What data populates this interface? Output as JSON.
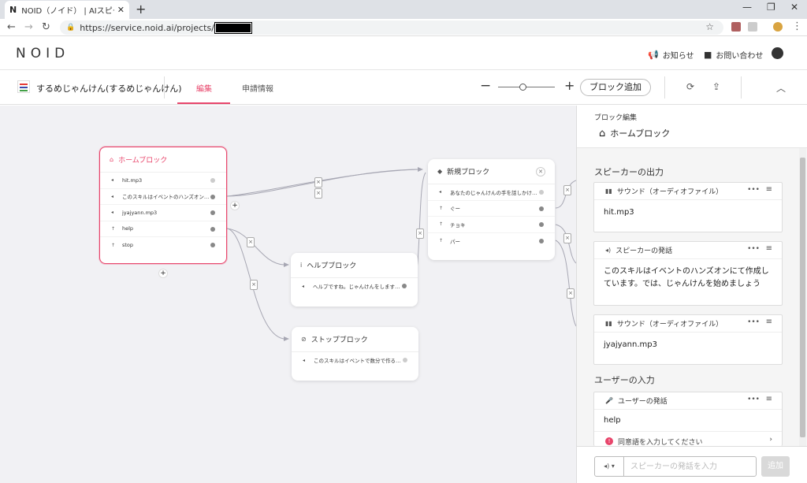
{
  "browser": {
    "tab_title": "NOID（ノイド） | AIスピーカースキルを",
    "tab_favicon": "N",
    "url": "https://service.noid.ai/projects/"
  },
  "header": {
    "logo": "NOID",
    "news": "お知らせ",
    "contact": "お問い合わせ"
  },
  "project": {
    "name": "するめじゃんけん(するめじゃんけん)",
    "tabs": [
      "編集",
      "申請情報"
    ],
    "add_block": "ブロック追加"
  },
  "canvas": {
    "home_block": {
      "title": "ホームブロック",
      "rows": [
        "hit.mp3",
        "このスキルはイベントのハンズオン…",
        "jyajyann.mp3",
        "help",
        "stop"
      ]
    },
    "new_block": {
      "title": "新規ブロック",
      "rows": [
        "あなたのじゃんけんの手を話しかけ…",
        "ぐー",
        "チョキ",
        "パー"
      ]
    },
    "help_block": {
      "title": "ヘルプブロック",
      "rows": [
        "ヘルプですね。じゃんけんをします…"
      ]
    },
    "stop_block": {
      "title": "ストップブロック",
      "rows": [
        "このスキルはイベントで数分で作る…"
      ]
    }
  },
  "panel": {
    "subtitle": "ブロック編集",
    "block_name": "ホームブロック",
    "speaker_section": "スピーカーの出力",
    "user_section": "ユーザーの入力",
    "cards": [
      {
        "type": "サウンド（オーディオファイル）",
        "body": "hit.mp3"
      },
      {
        "type": "スピーカーの発話",
        "body": "このスキルはイベントのハンズオンにて作成しています。では、じゃんけんを始めましょう"
      },
      {
        "type": "サウンド（オーディオファイル）",
        "body": "jyajyann.mp3"
      }
    ],
    "user_card": {
      "type": "ユーザーの発話",
      "body": "help",
      "hint": "同意語を入力してください"
    },
    "input_placeholder": "スピーカーの発話を入力",
    "add_button": "追加"
  },
  "colors": {
    "accent": "#e8456b",
    "canvas_bg": "#f1f1f4"
  }
}
